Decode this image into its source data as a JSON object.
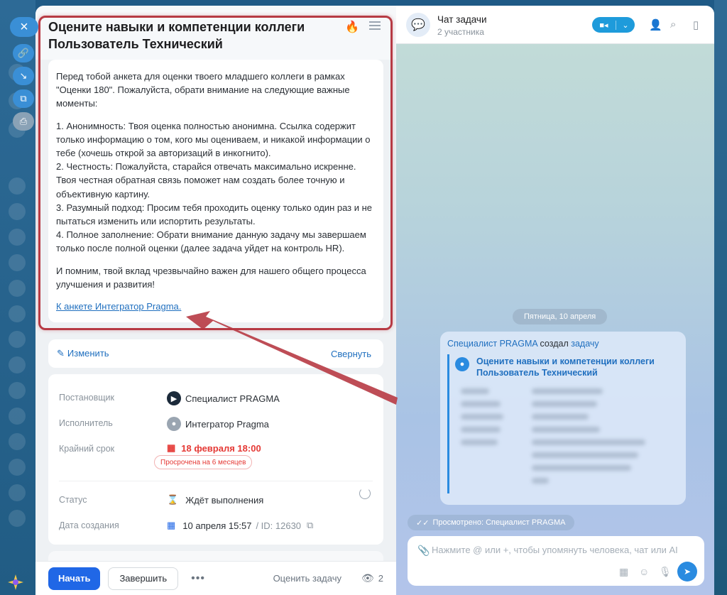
{
  "task": {
    "title": "Оцените навыки и компетенции коллеги Пользователь Технический",
    "description": {
      "intro": "Перед тобой анкета для оценки твоего младшего коллеги в рамках \"Оценки 180\". Пожалуйста, обрати внимание на следующие важные моменты:",
      "points": [
        "1. Анонимность: Твоя оценка полностью анонимна. Ссылка содержит только информацию о том, кого мы оцениваем, и никакой информации о тебе (хочешь открой за авторизаций в инкогнито).",
        "2. Честность: Пожалуйста, старайся отвечать максимально искренне. Твоя честная обратная связь поможет нам создать более точную и объективную картину.",
        "3. Разумный подход: Просим тебя проходить оценку только один раз и не пытаться изменить или испортить результаты.",
        "4. Полное заполнение: Обрати внимание данную задачу мы завершаем только после полной оценки (далее задача уйдет на контроль HR)."
      ],
      "closing": "И помним, твой вклад чрезвычайно важен для нашего общего процесса улучшения и развития!",
      "link": "К анкете Интегратор Pragma."
    },
    "actions": {
      "edit": "Изменить",
      "collapse": "Свернуть"
    },
    "info": {
      "creator_label": "Постановщик",
      "creator": "Специалист PRAGMA",
      "assignee_label": "Исполнитель",
      "assignee": "Интегратор Pragma",
      "deadline_label": "Крайний срок",
      "deadline": "18 февраля 18:00",
      "overdue": "Просрочена на 6 месяцев",
      "status_label": "Статус",
      "status": "Ждёт выполнения",
      "created_label": "Дата создания",
      "created": "10 апреля 15:57",
      "id": "/ ID: 12630"
    },
    "footer": {
      "start": "Начать",
      "finish": "Завершить",
      "more": "•••",
      "rate": "Оценить задачу",
      "watchers": "2"
    }
  },
  "chat": {
    "title": "Чат задачи",
    "subtitle": "2 участника",
    "date": "Пятница, 10 апреля",
    "message": {
      "author": "Специалист PRAGMA",
      "action": "создал",
      "object": "задачу",
      "task_title": "Оцените навыки и компетенции коллеги Пользователь Технический"
    },
    "viewed": "Просмотрено: Специалист PRAGMA",
    "composer_placeholder": "Нажмите @ или +, чтобы упомянуть человека, чат или AI"
  },
  "colors": {
    "accent": "#2067e6",
    "link": "#1f6fbf",
    "danger": "#e53935",
    "highlight_frame": "#b73a44"
  },
  "icons": [
    "close-icon",
    "link-icon",
    "download-icon",
    "open-icon",
    "print-icon",
    "fire-icon",
    "menu-icon",
    "pencil-icon",
    "calendar-icon",
    "hourglass-icon",
    "copy-icon",
    "eye-icon",
    "video-icon",
    "add-user-icon",
    "search-icon",
    "panel-icon",
    "attach-icon",
    "send-icon"
  ]
}
